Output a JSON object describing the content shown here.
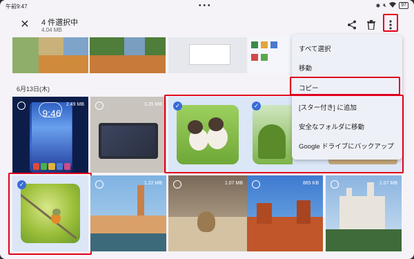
{
  "status_bar": {
    "time": "午前9:47",
    "battery": "97"
  },
  "header": {
    "title": "4 件選択中",
    "subtitle": "4.04 MB"
  },
  "date_heading": "6月13日(木)",
  "tiles": [
    {
      "size": "2.49 MB"
    },
    {
      "size": "3.25 MB"
    },
    {
      "size": ""
    },
    {
      "size": ""
    },
    {
      "size": ""
    },
    {
      "size": "1.22 MB"
    },
    {
      "size": "1.07 MB"
    },
    {
      "size": "865 KB"
    },
    {
      "size": "1.07 MB"
    }
  ],
  "phone_clock": "9:46",
  "menu": {
    "items": [
      "すべて選択",
      "移動",
      "コピー",
      "[スター付き] に追加",
      "安全なフォルダに移動",
      "Google ドライブにバックアップ"
    ]
  },
  "icons": [
    "close-icon",
    "share-icon",
    "trash-icon",
    "more-vert-icon",
    "check-icon"
  ],
  "colors": {
    "highlight": "#e0001b",
    "check": "#3a6cd8",
    "selected_bg": "#dbe6f7"
  }
}
